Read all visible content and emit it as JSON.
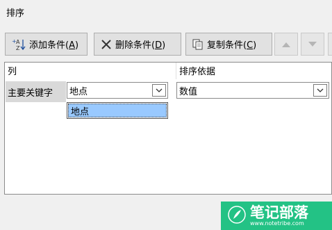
{
  "dialog": {
    "title": "排序"
  },
  "toolbar": {
    "add": {
      "label_pre": "添加条件(",
      "key": "A",
      "label_post": ")",
      "icon": "add-level-icon"
    },
    "delete": {
      "label_pre": "删除条件(",
      "key": "D",
      "label_post": ")",
      "icon": "delete-x-icon"
    },
    "copy": {
      "label_pre": "复制条件(",
      "key": "C",
      "label_post": ")",
      "icon": "copy-icon"
    },
    "move_up": {
      "icon": "triangle-up-icon"
    },
    "move_down": {
      "icon": "triangle-down-icon"
    }
  },
  "grid": {
    "headers": {
      "column": "列",
      "sort_on": "排序依据"
    },
    "row": {
      "label": "主要关键字",
      "column_value": "地点",
      "sort_on_value": "数值"
    },
    "dropdown_options": [
      "地点"
    ]
  },
  "watermark": {
    "title": "笔记部落",
    "url": "www.notetribe.com"
  }
}
